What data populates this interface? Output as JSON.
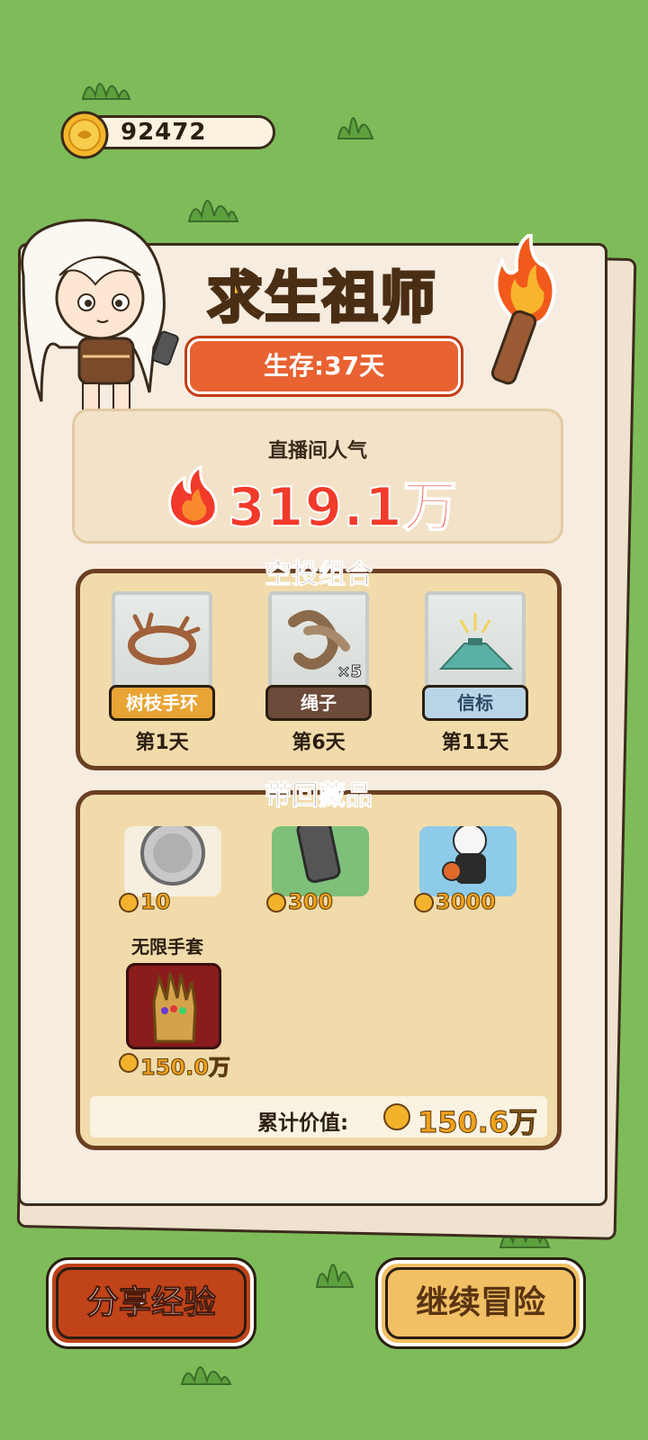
{
  "coins": {
    "value": "92472"
  },
  "title": "求生祖师",
  "survival": {
    "label": "生存:37天"
  },
  "popularity": {
    "label": "直播间人气",
    "value": "319.1万"
  },
  "airdrop": {
    "title": "空投组合",
    "items": [
      {
        "name": "树枝手环",
        "day": "第1天",
        "tag_color": "#e8a434",
        "text_color": "#ffffff",
        "qty": ""
      },
      {
        "name": "绳子",
        "day": "第6天",
        "tag_color": "#6d4a3a",
        "text_color": "#ffffff",
        "qty": "×5"
      },
      {
        "name": "信标",
        "day": "第11天",
        "tag_color": "#b8d4e6",
        "text_color": "#2b4a66",
        "qty": ""
      }
    ]
  },
  "collection": {
    "title": "带回藏品",
    "items": [
      {
        "name": "",
        "value": "10"
      },
      {
        "name": "",
        "value": "300"
      },
      {
        "name": "",
        "value": "3000"
      },
      {
        "name": "无限手套",
        "value": "150.0万"
      }
    ],
    "total_label": "累计价值:",
    "total_value": "150.6万"
  },
  "buttons": {
    "share": "分享经验",
    "continue": "继续冒险"
  },
  "colors": {
    "background": "#7ebc5a",
    "title": "#f2b53c",
    "survival_pill": "#e86232",
    "popularity_value": "#f23a2a",
    "share_button": "#c0431a",
    "continue_button": "#f2c064"
  }
}
